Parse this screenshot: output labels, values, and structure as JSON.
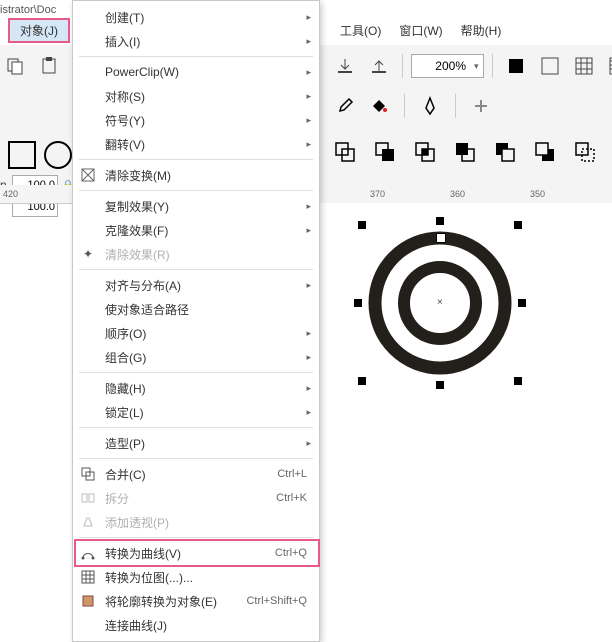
{
  "title_path": "istrator\\Doc",
  "menu_trigger": "对象(J)",
  "menubar": {
    "tools": "工具(O)",
    "window": "窗口(W)",
    "help": "帮助(H)"
  },
  "zoom": "200%",
  "coords": {
    "w": "100.0",
    "h": "100.0",
    "label_n": "n"
  },
  "ruler": {
    "t0": "420",
    "t1": "370",
    "t2": "360",
    "t3": "350"
  },
  "menu": {
    "create": "创建(T)",
    "insert": "插入(I)",
    "powerclip": "PowerClip(W)",
    "symmetry": "对称(S)",
    "symbol": "符号(Y)",
    "flip": "翻转(V)",
    "clear_transform": "清除变换(M)",
    "copy_effect": "复制效果(Y)",
    "clone_effect": "克隆效果(F)",
    "clear_effect": "清除效果(R)",
    "align": "对齐与分布(A)",
    "fit_path": "使对象适合路径",
    "order": "顺序(O)",
    "group": "组合(G)",
    "hide": "隐藏(H)",
    "lock": "锁定(L)",
    "shaping": "造型(P)",
    "merge": "合并(C)",
    "split": "拆分",
    "add_perspective": "添加透视(P)",
    "to_curve": "转换为曲线(V)",
    "to_bitmap": "转换为位图(...)...",
    "outline_to_object": "将轮廓转换为对象(E)",
    "join_curves": "连接曲线(J)"
  },
  "shortcuts": {
    "merge": "Ctrl+L",
    "split": "Ctrl+K",
    "to_curve": "Ctrl+Q",
    "outline_to_object": "Ctrl+Shift+Q"
  }
}
